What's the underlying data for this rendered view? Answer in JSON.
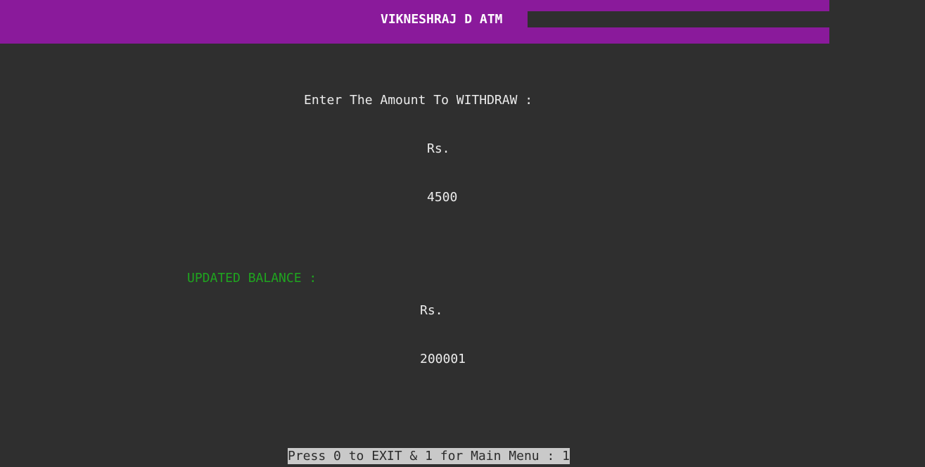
{
  "header": {
    "title": "VIKNESHRAJ D ATM"
  },
  "withdraw": {
    "prompt": "Enter The Amount To WITHDRAW :",
    "currency": "Rs.",
    "amount": "4500"
  },
  "balance": {
    "label": "UPDATED BALANCE :",
    "currency": "Rs.",
    "amount": "200001"
  },
  "footer": {
    "prompt": "Press 0 to EXIT & 1 for Main Menu : 1"
  },
  "colors": {
    "header": "#8a1a9b",
    "background": "#2f2f2f",
    "balance_label": "#1fa51f",
    "prompt_highlight": "#c9c9c9"
  }
}
